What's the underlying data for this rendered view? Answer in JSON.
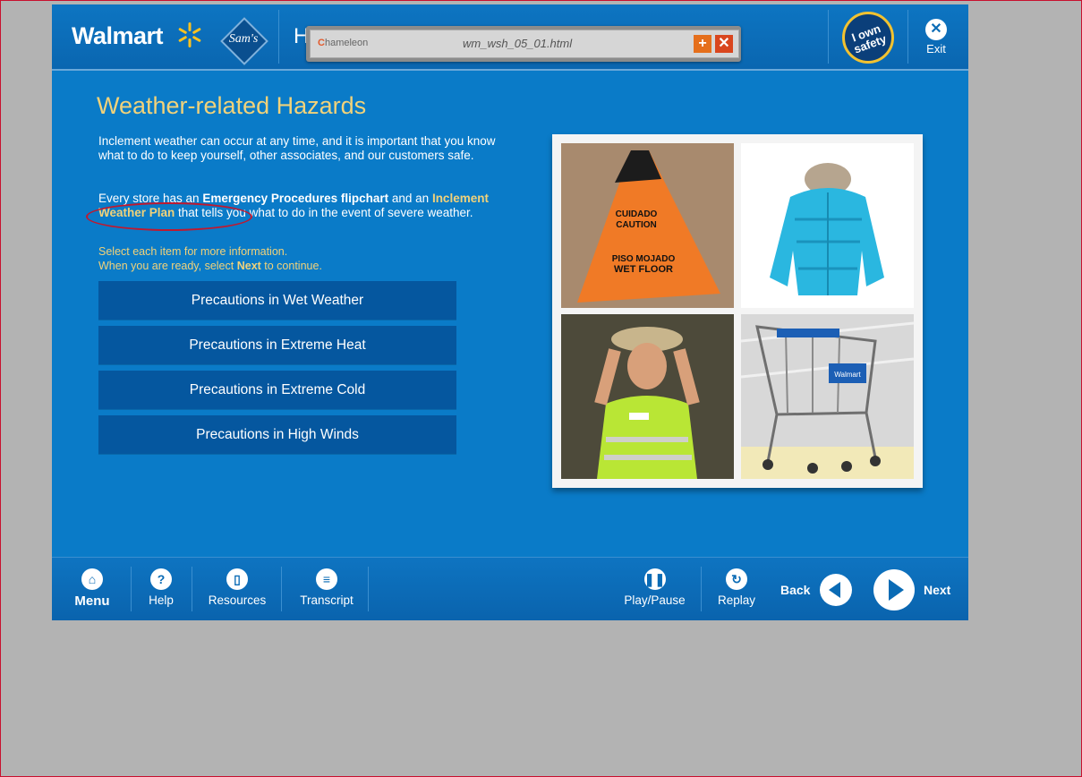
{
  "header": {
    "brand": "Walmart",
    "sams_club": "Sam's",
    "title_partial": "H",
    "own_safety": "I own safety",
    "exit_label": "Exit"
  },
  "overlay_toolbar": {
    "logo_text": "hameleon",
    "filename": "wm_wsh_05_01.html",
    "add_label": "+",
    "close_label": "✕"
  },
  "content": {
    "title": "Weather-related Hazards",
    "intro": "Inclement weather can occur at any time, and it is important that you know what to do to keep yourself, other associates, and our customers safe.",
    "p2_a": "Every store has an ",
    "p2_bold1": "Emergency Procedures flipchart",
    "p2_b": " and an ",
    "p2_bold2": "Inclement Weather Plan",
    "p2_c": " that tells you what to do in the event of severe weather.",
    "instruction_1": "Select each item for more information.",
    "instruction_2a": "When you are ready, select ",
    "instruction_2b": "Next",
    "instruction_2c": " to continue.",
    "buttons": [
      "Precautions in Wet Weather",
      "Precautions in Extreme Heat",
      "Precautions in Extreme Cold",
      "Precautions in High Winds"
    ]
  },
  "photos": {
    "cone_text_1": "CUIDADO",
    "cone_text_2": "CAUTION",
    "cone_text_3": "PISO MOJADO",
    "cone_text_4": "WET FLOOR",
    "cart_label": "Walmart"
  },
  "bottom_nav": {
    "menu": "Menu",
    "help": "Help",
    "resources": "Resources",
    "transcript": "Transcript",
    "play_pause": "Play/Pause",
    "replay": "Replay",
    "back": "Back",
    "next": "Next"
  },
  "colors": {
    "app_blue": "#0a7bc8",
    "button_blue": "#05579f",
    "title_gold": "#f1d27a",
    "annotation_red": "#c0192f"
  }
}
